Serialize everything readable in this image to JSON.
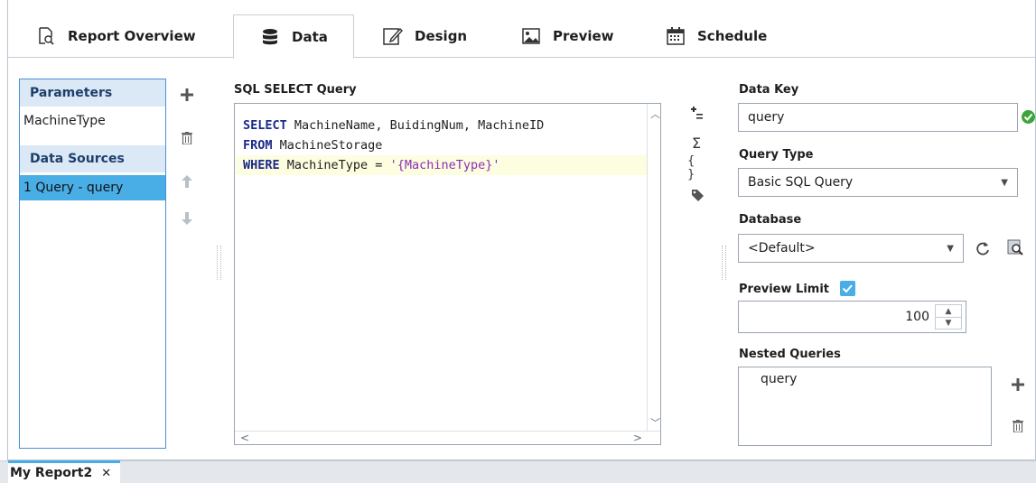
{
  "tabs": [
    {
      "label": "Report Overview",
      "icon": "report-overview-icon"
    },
    {
      "label": "Data",
      "icon": "database-icon"
    },
    {
      "label": "Design",
      "icon": "design-icon"
    },
    {
      "label": "Preview",
      "icon": "image-icon"
    },
    {
      "label": "Schedule",
      "icon": "calendar-icon"
    }
  ],
  "active_tab": "Data",
  "left_panel": {
    "parameters_header": "Parameters",
    "parameters": [
      "MachineType"
    ],
    "data_sources_header": "Data Sources",
    "data_sources": [
      "1 Query - query"
    ],
    "selected_data_source": "1 Query - query"
  },
  "sql": {
    "label": "SQL SELECT Query",
    "lines": [
      {
        "kw": "SELECT",
        "rest": " MachineName, BuidingNum, MachineID"
      },
      {
        "kw": "FROM",
        "rest": " MachineStorage"
      },
      {
        "kw": "WHERE",
        "rest": " MachineType = ",
        "str": "'{MachineType}'"
      }
    ]
  },
  "form": {
    "data_key_label": "Data Key",
    "data_key_value": "query",
    "query_type_label": "Query Type",
    "query_type_value": "Basic SQL Query",
    "database_label": "Database",
    "database_value": "<Default>",
    "preview_limit_label": "Preview Limit",
    "preview_limit_enabled": true,
    "preview_limit_value": "100",
    "nested_queries_label": "Nested Queries",
    "nested_queries": [
      "query"
    ]
  },
  "bottom": {
    "doc_tab_label": "My Report2",
    "close_glyph": "✕"
  },
  "colors": {
    "accent": "#4aaee6",
    "panel_header": "#dbe8f6",
    "keyword": "#1a2a8c",
    "string": "#8b2fb5",
    "valid_green": "#3aa63a"
  }
}
